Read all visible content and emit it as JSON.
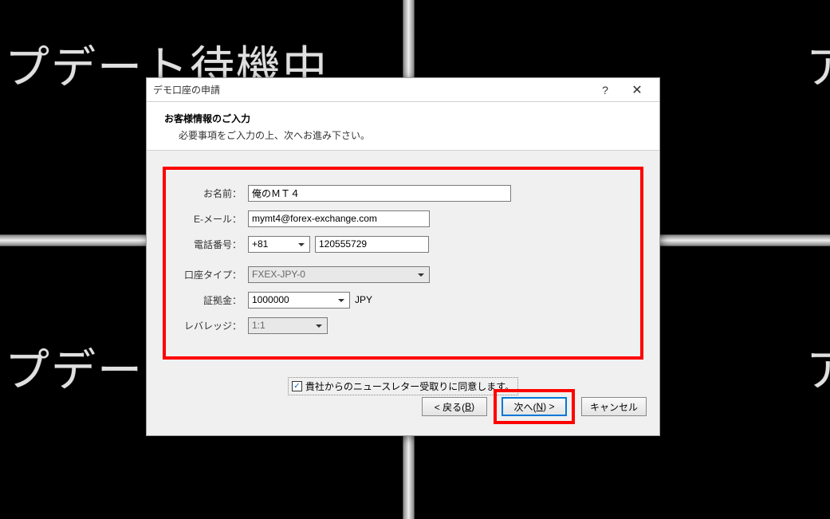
{
  "background": {
    "text_full": "アップデート待機中",
    "text_partial": "アップデー"
  },
  "dialog": {
    "title": "デモ口座の申請",
    "header_title": "お客様情報のご入力",
    "header_sub": "必要事項をご入力の上、次へお進み下さい。",
    "fields": {
      "name": {
        "label": "お名前：",
        "value": "俺のＭＴ４"
      },
      "email": {
        "label": "E-メール：",
        "value": "mymt4@forex-exchange.com"
      },
      "phone": {
        "label": "電話番号：",
        "code": "+81",
        "number": "120555729"
      },
      "account_type": {
        "label": "口座タイプ：",
        "value": "FXEX-JPY-0"
      },
      "deposit": {
        "label": "証拠金：",
        "value": "1000000",
        "currency": "JPY"
      },
      "leverage": {
        "label": "レバレッジ：",
        "value": "1:1"
      }
    },
    "consent": {
      "checked": true,
      "label": "貴社からのニュースレター受取りに同意します。"
    },
    "buttons": {
      "back": {
        "prefix": "< 戻る(",
        "hotkey": "B",
        "suffix": ")"
      },
      "next": {
        "prefix": "次へ(",
        "hotkey": "N",
        "suffix": ") >"
      },
      "cancel": "キャンセル"
    },
    "help_symbol": "?",
    "close_symbol": "✕"
  }
}
